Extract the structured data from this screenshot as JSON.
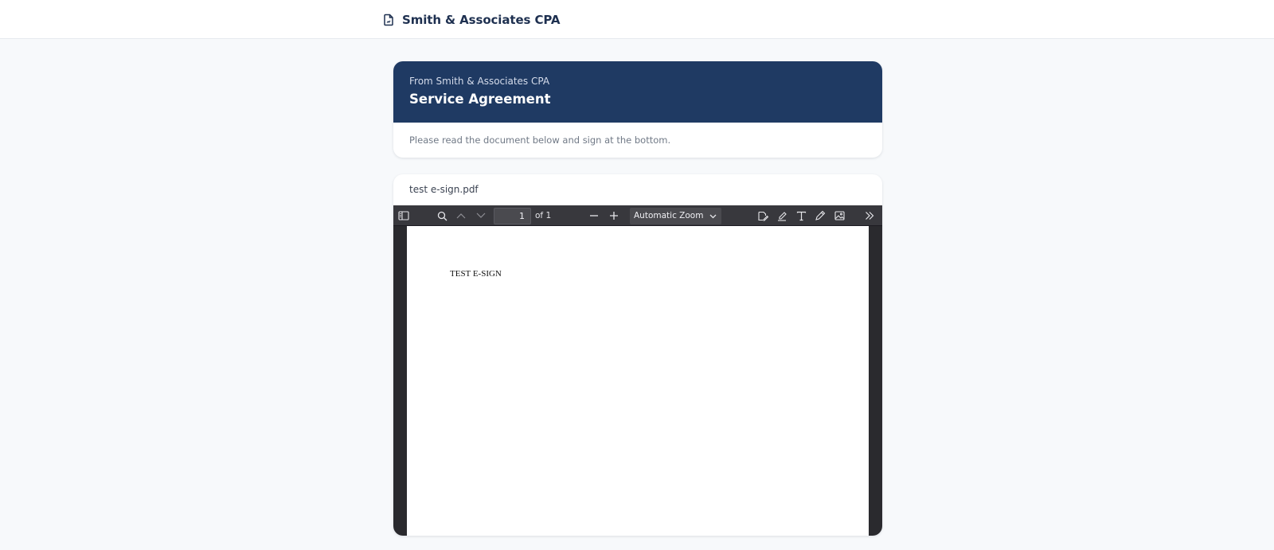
{
  "header": {
    "firm_name": "Smith & Associates CPA",
    "logo_icon": "document-icon"
  },
  "request": {
    "from_label": "From Smith & Associates CPA",
    "title": "Service Agreement",
    "instructions": "Please read the document below and sign at the bottom."
  },
  "document": {
    "filename": "test e-sign.pdf",
    "viewer": {
      "current_page": "1",
      "page_count_label": "of 1",
      "zoom_label": "Automatic Zoom",
      "toolbar_icons": [
        "sidebar-toggle-icon",
        "search-icon",
        "previous-page-icon",
        "next-page-icon",
        "zoom-out-icon",
        "zoom-in-icon",
        "signature-icon",
        "highlight-icon",
        "text-icon",
        "draw-icon",
        "image-icon",
        "tools-menu-icon"
      ]
    },
    "page_content": "TEST E-SIGN"
  },
  "colors": {
    "header_band": "#1f3a63",
    "page_background": "#f7f9fb",
    "viewer_toolbar": "#38383d"
  }
}
